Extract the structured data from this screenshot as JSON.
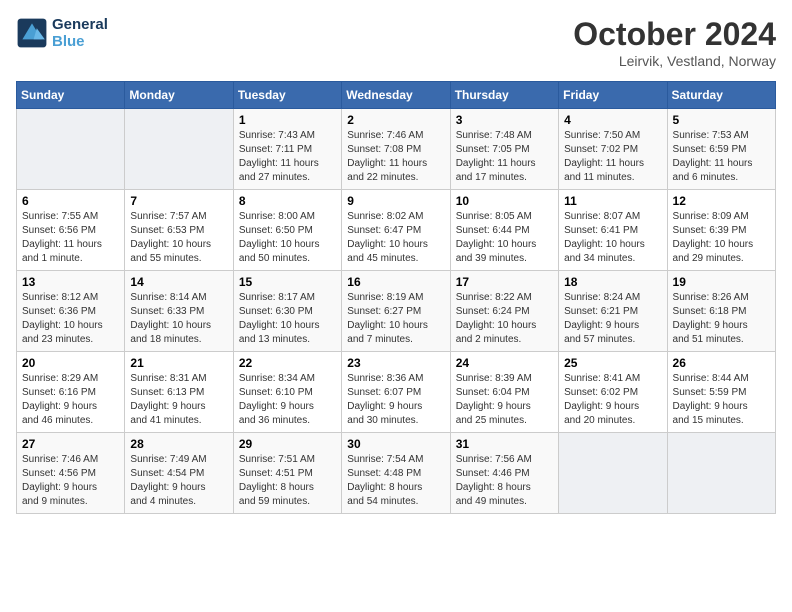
{
  "header": {
    "logo_line1": "General",
    "logo_line2": "Blue",
    "month_title": "October 2024",
    "location": "Leirvik, Vestland, Norway"
  },
  "weekdays": [
    "Sunday",
    "Monday",
    "Tuesday",
    "Wednesday",
    "Thursday",
    "Friday",
    "Saturday"
  ],
  "weeks": [
    {
      "days": [
        {
          "num": "",
          "info": ""
        },
        {
          "num": "",
          "info": ""
        },
        {
          "num": "1",
          "info": "Sunrise: 7:43 AM\nSunset: 7:11 PM\nDaylight: 11 hours\nand 27 minutes."
        },
        {
          "num": "2",
          "info": "Sunrise: 7:46 AM\nSunset: 7:08 PM\nDaylight: 11 hours\nand 22 minutes."
        },
        {
          "num": "3",
          "info": "Sunrise: 7:48 AM\nSunset: 7:05 PM\nDaylight: 11 hours\nand 17 minutes."
        },
        {
          "num": "4",
          "info": "Sunrise: 7:50 AM\nSunset: 7:02 PM\nDaylight: 11 hours\nand 11 minutes."
        },
        {
          "num": "5",
          "info": "Sunrise: 7:53 AM\nSunset: 6:59 PM\nDaylight: 11 hours\nand 6 minutes."
        }
      ]
    },
    {
      "days": [
        {
          "num": "6",
          "info": "Sunrise: 7:55 AM\nSunset: 6:56 PM\nDaylight: 11 hours\nand 1 minute."
        },
        {
          "num": "7",
          "info": "Sunrise: 7:57 AM\nSunset: 6:53 PM\nDaylight: 10 hours\nand 55 minutes."
        },
        {
          "num": "8",
          "info": "Sunrise: 8:00 AM\nSunset: 6:50 PM\nDaylight: 10 hours\nand 50 minutes."
        },
        {
          "num": "9",
          "info": "Sunrise: 8:02 AM\nSunset: 6:47 PM\nDaylight: 10 hours\nand 45 minutes."
        },
        {
          "num": "10",
          "info": "Sunrise: 8:05 AM\nSunset: 6:44 PM\nDaylight: 10 hours\nand 39 minutes."
        },
        {
          "num": "11",
          "info": "Sunrise: 8:07 AM\nSunset: 6:41 PM\nDaylight: 10 hours\nand 34 minutes."
        },
        {
          "num": "12",
          "info": "Sunrise: 8:09 AM\nSunset: 6:39 PM\nDaylight: 10 hours\nand 29 minutes."
        }
      ]
    },
    {
      "days": [
        {
          "num": "13",
          "info": "Sunrise: 8:12 AM\nSunset: 6:36 PM\nDaylight: 10 hours\nand 23 minutes."
        },
        {
          "num": "14",
          "info": "Sunrise: 8:14 AM\nSunset: 6:33 PM\nDaylight: 10 hours\nand 18 minutes."
        },
        {
          "num": "15",
          "info": "Sunrise: 8:17 AM\nSunset: 6:30 PM\nDaylight: 10 hours\nand 13 minutes."
        },
        {
          "num": "16",
          "info": "Sunrise: 8:19 AM\nSunset: 6:27 PM\nDaylight: 10 hours\nand 7 minutes."
        },
        {
          "num": "17",
          "info": "Sunrise: 8:22 AM\nSunset: 6:24 PM\nDaylight: 10 hours\nand 2 minutes."
        },
        {
          "num": "18",
          "info": "Sunrise: 8:24 AM\nSunset: 6:21 PM\nDaylight: 9 hours\nand 57 minutes."
        },
        {
          "num": "19",
          "info": "Sunrise: 8:26 AM\nSunset: 6:18 PM\nDaylight: 9 hours\nand 51 minutes."
        }
      ]
    },
    {
      "days": [
        {
          "num": "20",
          "info": "Sunrise: 8:29 AM\nSunset: 6:16 PM\nDaylight: 9 hours\nand 46 minutes."
        },
        {
          "num": "21",
          "info": "Sunrise: 8:31 AM\nSunset: 6:13 PM\nDaylight: 9 hours\nand 41 minutes."
        },
        {
          "num": "22",
          "info": "Sunrise: 8:34 AM\nSunset: 6:10 PM\nDaylight: 9 hours\nand 36 minutes."
        },
        {
          "num": "23",
          "info": "Sunrise: 8:36 AM\nSunset: 6:07 PM\nDaylight: 9 hours\nand 30 minutes."
        },
        {
          "num": "24",
          "info": "Sunrise: 8:39 AM\nSunset: 6:04 PM\nDaylight: 9 hours\nand 25 minutes."
        },
        {
          "num": "25",
          "info": "Sunrise: 8:41 AM\nSunset: 6:02 PM\nDaylight: 9 hours\nand 20 minutes."
        },
        {
          "num": "26",
          "info": "Sunrise: 8:44 AM\nSunset: 5:59 PM\nDaylight: 9 hours\nand 15 minutes."
        }
      ]
    },
    {
      "days": [
        {
          "num": "27",
          "info": "Sunrise: 7:46 AM\nSunset: 4:56 PM\nDaylight: 9 hours\nand 9 minutes."
        },
        {
          "num": "28",
          "info": "Sunrise: 7:49 AM\nSunset: 4:54 PM\nDaylight: 9 hours\nand 4 minutes."
        },
        {
          "num": "29",
          "info": "Sunrise: 7:51 AM\nSunset: 4:51 PM\nDaylight: 8 hours\nand 59 minutes."
        },
        {
          "num": "30",
          "info": "Sunrise: 7:54 AM\nSunset: 4:48 PM\nDaylight: 8 hours\nand 54 minutes."
        },
        {
          "num": "31",
          "info": "Sunrise: 7:56 AM\nSunset: 4:46 PM\nDaylight: 8 hours\nand 49 minutes."
        },
        {
          "num": "",
          "info": ""
        },
        {
          "num": "",
          "info": ""
        }
      ]
    }
  ]
}
